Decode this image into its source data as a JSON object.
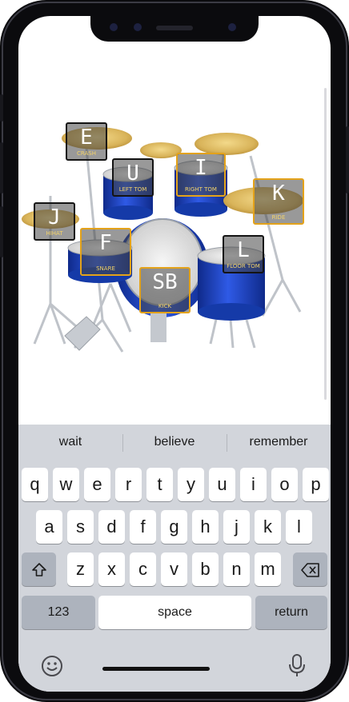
{
  "drum_pads": [
    {
      "id": "crash",
      "key": "E",
      "label": "CRASH"
    },
    {
      "id": "left-tom",
      "key": "U",
      "label": "LEFT TOM"
    },
    {
      "id": "right-tom",
      "key": "I",
      "label": "RIGHT TOM"
    },
    {
      "id": "ride",
      "key": "K",
      "label": "RIDE"
    },
    {
      "id": "hihat",
      "key": "J",
      "label": "HIHAT"
    },
    {
      "id": "snare",
      "key": "F",
      "label": "SNARE"
    },
    {
      "id": "floor-tom",
      "key": "L",
      "label": "FLOOR TOM"
    },
    {
      "id": "kick",
      "key": "SB",
      "label": "KICK"
    }
  ],
  "keyboard": {
    "suggestions": [
      "wait",
      "believe",
      "remember"
    ],
    "row1": [
      "q",
      "w",
      "e",
      "r",
      "t",
      "y",
      "u",
      "i",
      "o",
      "p"
    ],
    "row2": [
      "a",
      "s",
      "d",
      "f",
      "g",
      "h",
      "j",
      "k",
      "l"
    ],
    "row3": [
      "z",
      "x",
      "c",
      "v",
      "b",
      "n",
      "m"
    ],
    "numbers_label": "123",
    "space_label": "space",
    "return_label": "return"
  },
  "icons": {
    "shift": "shift-icon",
    "backspace": "backspace-icon",
    "emoji": "emoji-icon",
    "microphone": "microphone-icon"
  },
  "colors": {
    "pad_border_active": "#e3a21a",
    "drum_shell": "#1f46c9",
    "keyboard_bg": "#d2d5db"
  }
}
